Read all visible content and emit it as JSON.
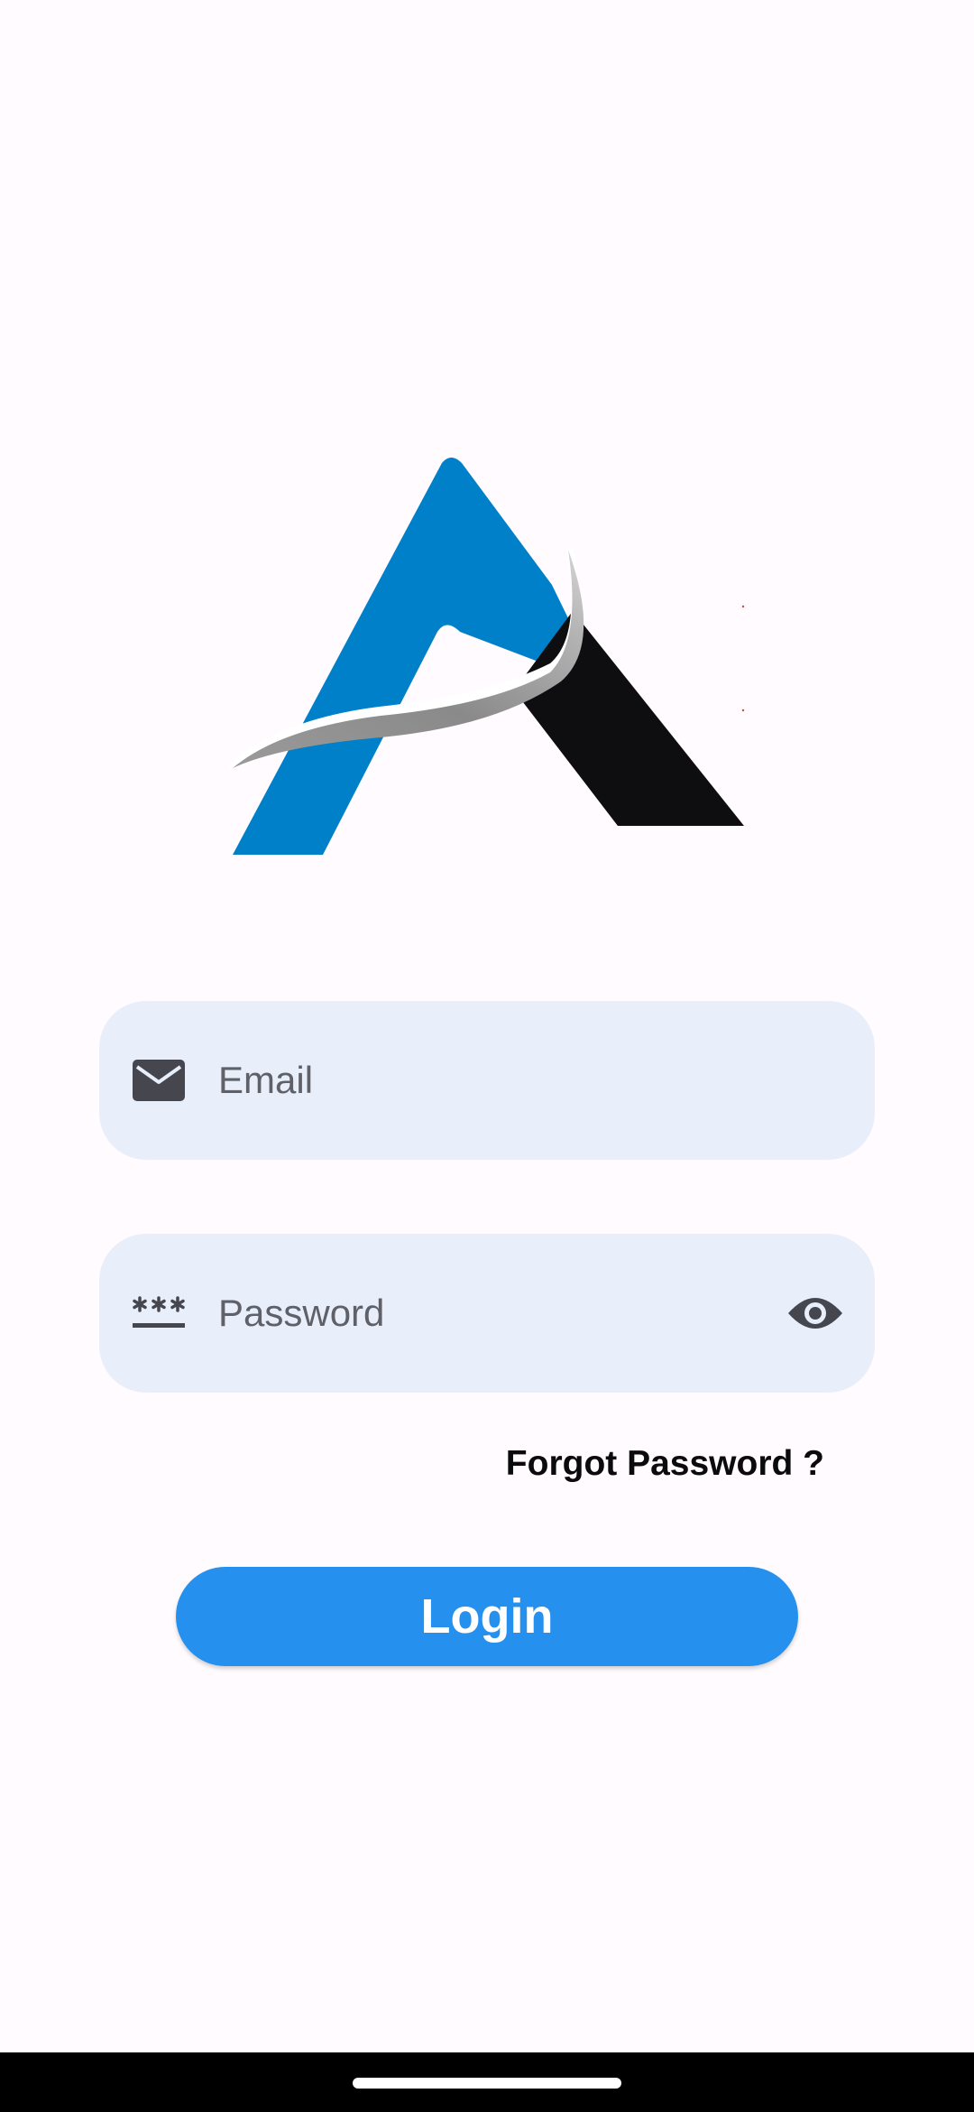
{
  "app": {
    "logo_icon": "brand-a-logo"
  },
  "login_form": {
    "email": {
      "icon": "email-icon",
      "placeholder": "Email",
      "value": ""
    },
    "password": {
      "icon": "password-icon",
      "placeholder": "Password",
      "value": "",
      "toggle_icon": "eye-icon"
    },
    "forgot_password_label": "Forgot Password ?",
    "login_label": "Login"
  },
  "colors": {
    "background": "#fffbfe",
    "field_background": "#e8effa",
    "primary": "#2690ee",
    "logo_blue": "#0080c8",
    "logo_black": "#0e0e10",
    "logo_silver": "#a6a6a6",
    "icon": "#46464f"
  }
}
